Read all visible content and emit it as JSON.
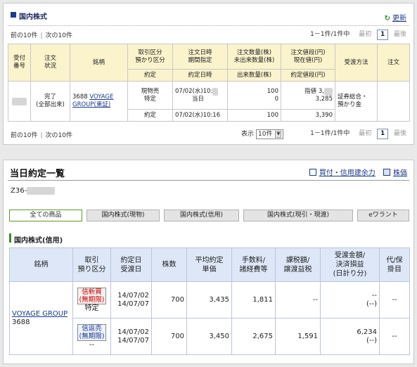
{
  "order_panel": {
    "title": "国内株式",
    "refresh": "更新",
    "pager_prev": "前の10件",
    "pager_next": "次の10件",
    "count": "1－1件/1件中",
    "first": "最初",
    "last": "最後",
    "page": "1",
    "display_label": "表示",
    "display_value": "10件",
    "headers": {
      "receipt_no": "受付\n番号",
      "order_status": "注文\n状況",
      "security": "銘柄",
      "trade_type": "取引区分\n預かり区分",
      "order_datetime": "注文日時\n期間指定",
      "order_qty": "注文数量(株)\n未出来数量(株)",
      "order_price": "注文値段(円)\n現在値(円)",
      "delivery": "受渡方法",
      "note": "注文",
      "exec": "約定",
      "exec_datetime": "約定日時",
      "exec_qty": "出来数量(株)",
      "exec_price": "約定値段(円)"
    },
    "row": {
      "status": "完了\n(全部出来)",
      "code": "3688",
      "name": "VOYAGE GROUP(東証)",
      "trade_type": "現物売",
      "custody": "特定",
      "datetime": "07/02(水)10:",
      "period": "当日",
      "qty": "100",
      "unfilled": "0",
      "price_type": "指値",
      "price": "3,",
      "current": "3,285",
      "delivery": "証券総合・\n預かり金",
      "exec_label": "約定",
      "exec_datetime": "07/02(水)10:16",
      "exec_qty": "100",
      "exec_price": "3,390"
    }
  },
  "exec_panel": {
    "title": "当日約定一覧",
    "link1": "買付・信用建余力",
    "link2": "株価",
    "account": "Z36-",
    "tabs": [
      "全ての商品",
      "国内株式(現物)",
      "国内株式(信用)",
      "国内株式(現引・現渡)",
      "eワラント"
    ],
    "section": "国内株式(信用)",
    "headers": {
      "security": "銘柄",
      "trade": "取引\n預り区分",
      "dates": "約定日\n受渡日",
      "shares": "株数",
      "avg_price": "平均約定\n単価",
      "fee": "手数料/\n諸経費等",
      "tax": "課税額/\n譲渡益税",
      "settle": "受渡金額/\n決済損益\n(日計り分)",
      "pay": "代/保\n掛目"
    },
    "security_name": "VOYAGE GROUP",
    "security_code": "3688",
    "rows": [
      {
        "trade": "信新買\n(無期限)",
        "custody": "特定",
        "trade_date": "14/07/02",
        "settle_date": "14/07/07",
        "shares": "700",
        "price": "3,435",
        "fee": "1,811",
        "tax": "--",
        "amount": "--",
        "pnl": "(--)",
        "pay": "--"
      },
      {
        "trade": "信返売\n(無期限)",
        "custody": "--",
        "trade_date": "14/07/02",
        "settle_date": "14/07/07",
        "shares": "700",
        "price": "3,450",
        "fee": "2,675",
        "tax": "1,591",
        "amount": "6,234",
        "pnl": "(--)",
        "pay": "--"
      }
    ]
  }
}
